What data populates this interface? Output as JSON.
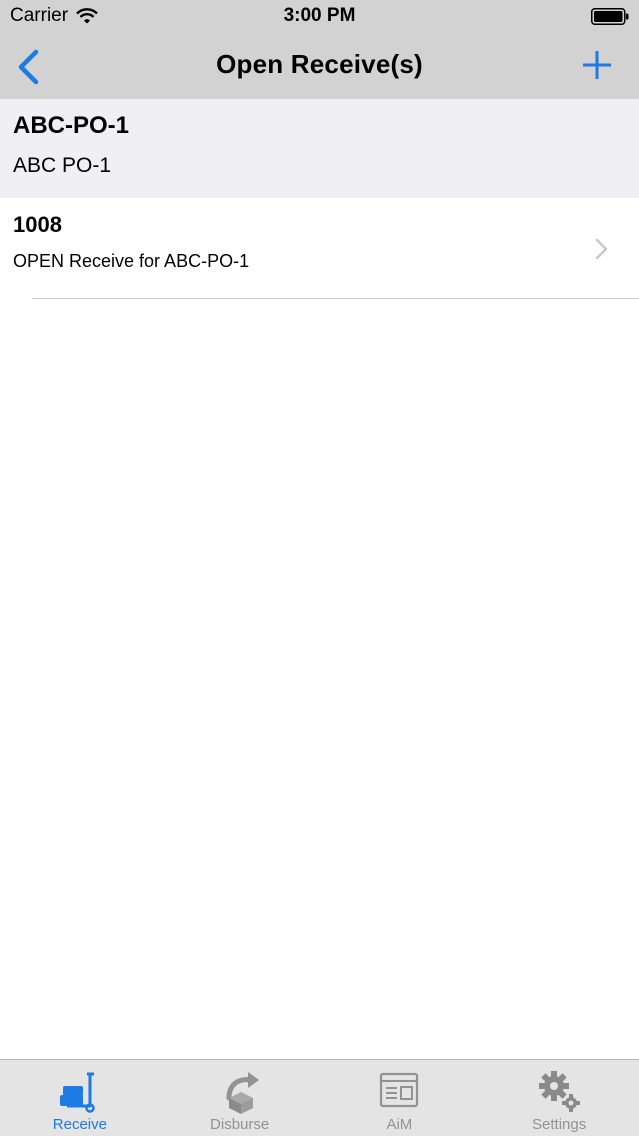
{
  "status_bar": {
    "carrier": "Carrier",
    "time": "3:00 PM"
  },
  "nav": {
    "title": "Open Receive(s)",
    "back_icon": "chevron-left-icon",
    "add_icon": "plus-icon"
  },
  "section": {
    "title": "ABC-PO-1",
    "subtitle": "ABC PO-1"
  },
  "rows": [
    {
      "title": "1008",
      "subtitle": "OPEN Receive for ABC-PO-1"
    }
  ],
  "tabs": [
    {
      "label": "Receive",
      "icon": "hand-truck-icon",
      "active": true
    },
    {
      "label": "Disburse",
      "icon": "box-arrow-icon",
      "active": false
    },
    {
      "label": "AiM",
      "icon": "window-icon",
      "active": false
    },
    {
      "label": "Settings",
      "icon": "gears-icon",
      "active": false
    }
  ],
  "colors": {
    "accent": "#1e7ae4",
    "bar_background": "#d2d2d2",
    "section_background": "#efeff4",
    "tab_inactive": "#929292"
  }
}
